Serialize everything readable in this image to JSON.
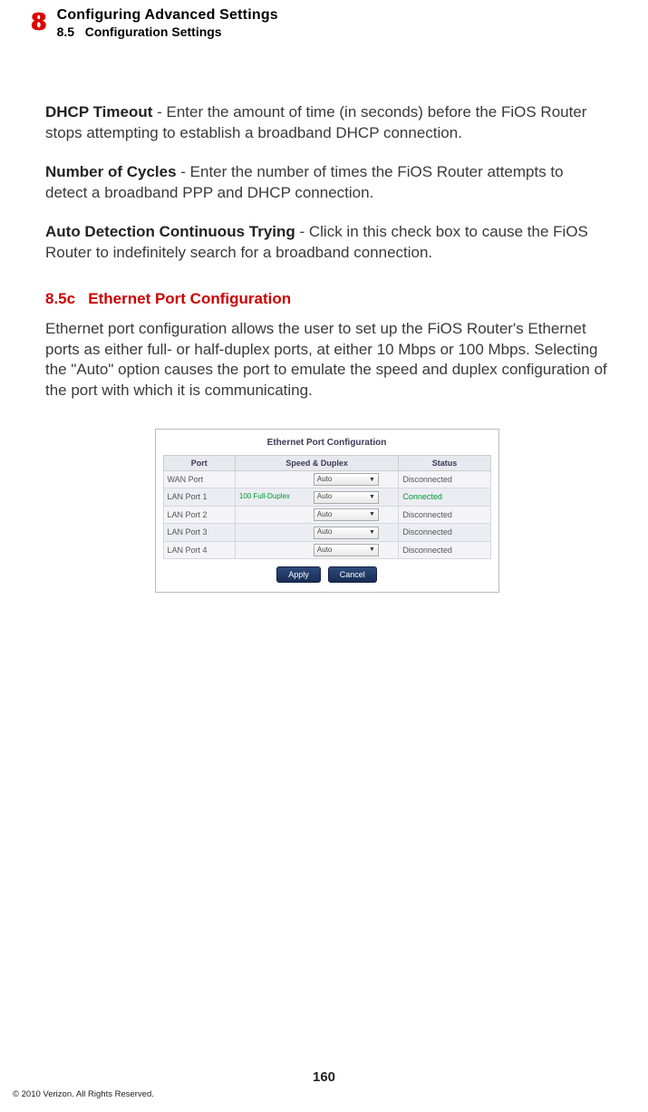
{
  "header": {
    "chapter_number": "8",
    "chapter_title": "Configuring Advanced Settings",
    "section_number": "8.5",
    "section_name": "Configuration Settings"
  },
  "paragraphs": [
    {
      "term": "DHCP Timeout",
      "body": " - Enter the amount of time (in seconds) before the FiOS Router stops attempting to establish a broadband DHCP connection."
    },
    {
      "term": "Number of Cycles",
      "body": " - Enter the number of times the FiOS Router attempts to detect a broadband PPP and DHCP connection."
    },
    {
      "term": "Auto Detection Continuous Trying",
      "body": " - Click in this check box to cause the FiOS Router to indefinitely search for a broadband connection."
    }
  ],
  "subsection": {
    "number": "8.5c",
    "title": "Ethernet Port Configuration",
    "body": "Ethernet port configuration allows the user to set up the FiOS Router's Ethernet ports as either full- or half-duplex ports, at either 10 Mbps or 100 Mbps. Selecting the \"Auto\" option causes the port to emulate the speed and duplex configuration of the port with which it is communicating."
  },
  "figure": {
    "title": "Ethernet Port Configuration",
    "columns": {
      "c1": "Port",
      "c2": "Speed & Duplex",
      "c3": "Status"
    },
    "rows": [
      {
        "port": "WAN Port",
        "note": "",
        "dropdown": "Auto",
        "status": "Disconnected",
        "connected": false
      },
      {
        "port": "LAN Port 1",
        "note": "100 Full-Duplex",
        "dropdown": "Auto",
        "status": "Connected",
        "connected": true
      },
      {
        "port": "LAN Port 2",
        "note": "",
        "dropdown": "Auto",
        "status": "Disconnected",
        "connected": false
      },
      {
        "port": "LAN Port 3",
        "note": "",
        "dropdown": "Auto",
        "status": "Disconnected",
        "connected": false
      },
      {
        "port": "LAN Port 4",
        "note": "",
        "dropdown": "Auto",
        "status": "Disconnected",
        "connected": false
      }
    ],
    "buttons": {
      "apply": "Apply",
      "cancel": "Cancel"
    }
  },
  "footer": {
    "page_number": "160",
    "copyright": "© 2010 Verizon. All Rights Reserved."
  }
}
